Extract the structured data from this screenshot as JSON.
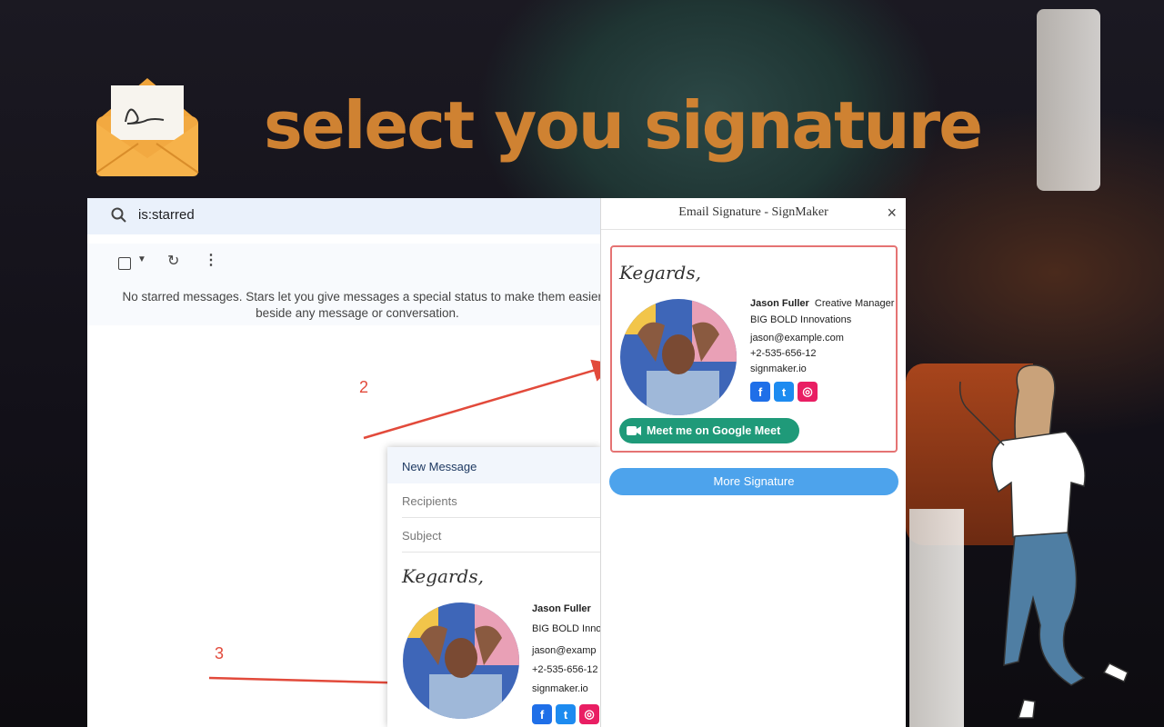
{
  "headline": {
    "text": "select you signature",
    "color": "#cf8232"
  },
  "gmail": {
    "search_query": "is:starred",
    "empty_line1": "No starred messages. Stars let you give messages a special status to make them easier t",
    "empty_line2": "beside any message or conversation."
  },
  "annotations": {
    "step2": "2",
    "step3": "3"
  },
  "compose": {
    "title": "New Message",
    "recipients_placeholder": "Recipients",
    "subject_placeholder": "Subject",
    "signature": {
      "greeting": "Kegards,",
      "name": "Jason Fuller",
      "company": "BIG BOLD Inno",
      "email": "jason@examp",
      "phone": "+2-535-656-12",
      "website": "signmaker.io"
    }
  },
  "panel": {
    "title": "Email Signature - SignMaker",
    "close": "×",
    "signature": {
      "greeting": "Kegards,",
      "name": "Jason Fuller",
      "role": "Creative Manager",
      "company": "BIG BOLD Innovations",
      "email": "jason@example.com",
      "phone": "+2-535-656-12",
      "website": "signmaker.io",
      "meet_label": "Meet me on Google Meet"
    },
    "more_label": "More Signature"
  },
  "icons": {
    "social": [
      "facebook-icon",
      "twitter-icon",
      "instagram-icon"
    ]
  }
}
